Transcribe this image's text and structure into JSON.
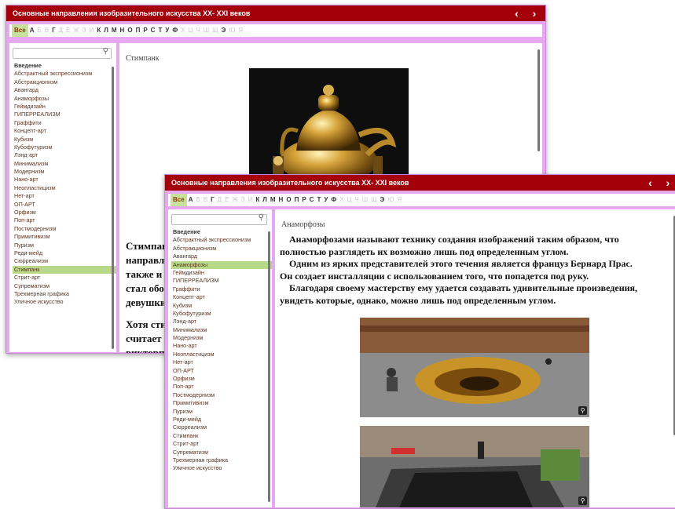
{
  "alphabet": [
    "Все",
    "А",
    "Б",
    "В",
    "Г",
    "Д",
    "Е",
    "Ж",
    "З",
    "И",
    "К",
    "Л",
    "М",
    "Н",
    "О",
    "П",
    "Р",
    "С",
    "Т",
    "У",
    "Ф",
    "Х",
    "Ц",
    "Ч",
    "Ш",
    "Щ",
    "Э",
    "Ю",
    "Я"
  ],
  "alphabet_disabled": [
    "Б",
    "В",
    "Д",
    "Е",
    "Ж",
    "З",
    "И",
    "Х",
    "Ц",
    "Ч",
    "Ш",
    "Щ",
    "Ю",
    "Я"
  ],
  "nav": {
    "prev": "‹",
    "next": "›"
  },
  "items": [
    "Введение",
    "Абстрактный экспрессионизм",
    "Абстракционизм",
    "Авангард",
    "Анаморфозы",
    "Геймдизайн",
    "ГИПЕРРЕАЛИЗМ",
    "Граффити",
    "Концепт-арт",
    "Кубизм",
    "Кубофутуризм",
    "Лэнд-арт",
    "Минимализм",
    "Модернизм",
    "Нано-арт",
    "Неопластицизм",
    "Нет-арт",
    "ОП-АРТ",
    "Орфизм",
    "Поп-арт",
    "Постмодернизм",
    "Примитивизм",
    "Пуризм",
    "Реди-мейд",
    "Сюрреализм",
    "Стимпанк",
    "Стрит-арт",
    "Супрематизм",
    "Трехмерная графика",
    "Уличное искусство"
  ],
  "back": {
    "title": "Основные направления изобразительного искусства XX- XXI веков",
    "selected": "Стимпанк",
    "section_title": "Стимпанк",
    "text_lines": [
      "Стимпан",
      "направл",
      "также и",
      "стал обо",
      "девушки"
    ],
    "text2_lines": [
      "Хотя сти",
      "считает",
      "викторп"
    ]
  },
  "front": {
    "title": "Основные направления изобразительного искусства XX- XXI веков",
    "selected": "Анаморфозы",
    "section_title": "Анаморфозы",
    "lines": [
      "    Анаморфозами называют технику создания изображений таким образом, что",
      "полностью разглядеть их возможно лишь под определенным углом.",
      "    Одним из ярких представителей этого течения является француз Бернард Прас.",
      "Он создает инсталляции с использованием того, что попадется под руку.",
      "    Благодаря своему мастерству ему удается создавать удивительные произведения,",
      "увидеть которые, однако, можно лишь под определенным углом."
    ]
  }
}
